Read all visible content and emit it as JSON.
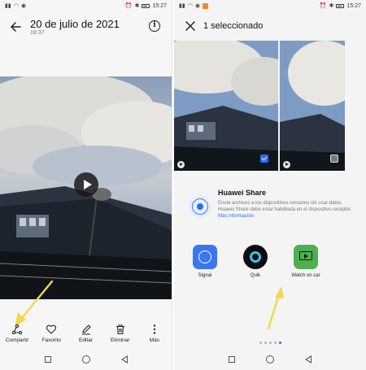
{
  "left": {
    "status": {
      "time": "15:27"
    },
    "header": {
      "title": "20 de julio de 2021",
      "subtitle": "18:37"
    },
    "actions": [
      {
        "label": "Compartir",
        "icon": "share-icon"
      },
      {
        "label": "Favorito",
        "icon": "heart-icon"
      },
      {
        "label": "Editar",
        "icon": "pencil-icon"
      },
      {
        "label": "Eliminar",
        "icon": "trash-icon"
      },
      {
        "label": "Más",
        "icon": "more-vert-icon"
      }
    ]
  },
  "right": {
    "status": {
      "time": "15:27"
    },
    "header": {
      "title": "1 seleccionado"
    },
    "huawei_share": {
      "title": "Huawei Share",
      "description": "Envíe archivos a los dispositivos cercanos sin usar datos. Huawei Share debe estar habilitada en el dispositivo receptor.",
      "link": "Más información"
    },
    "apps": [
      {
        "label": "Signal"
      },
      {
        "label": "Quik"
      },
      {
        "label": "Watch on car"
      }
    ],
    "page_dots": {
      "count": 5,
      "active": 4
    }
  },
  "colors": {
    "accent": "#2c6ef2",
    "annotation_arrow": "#f4d84a"
  }
}
